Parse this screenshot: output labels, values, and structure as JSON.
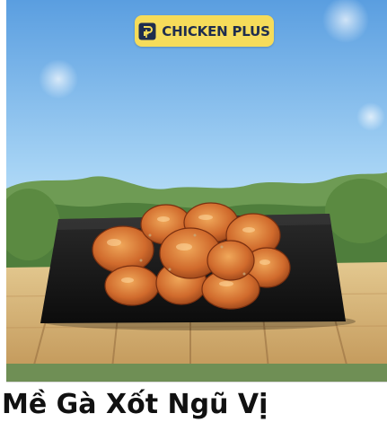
{
  "product": {
    "brand": "CHICKEN PLUS",
    "title": "Mề Gà Xốt Ngũ Vị",
    "image_icon": "fried-chicken-on-black-plate",
    "brand_logo_icon": "chicken-plus-logo-icon"
  },
  "colors": {
    "badge_background": "#f6dc5a",
    "badge_text": "#1f2d4e",
    "title_text": "#111111"
  }
}
